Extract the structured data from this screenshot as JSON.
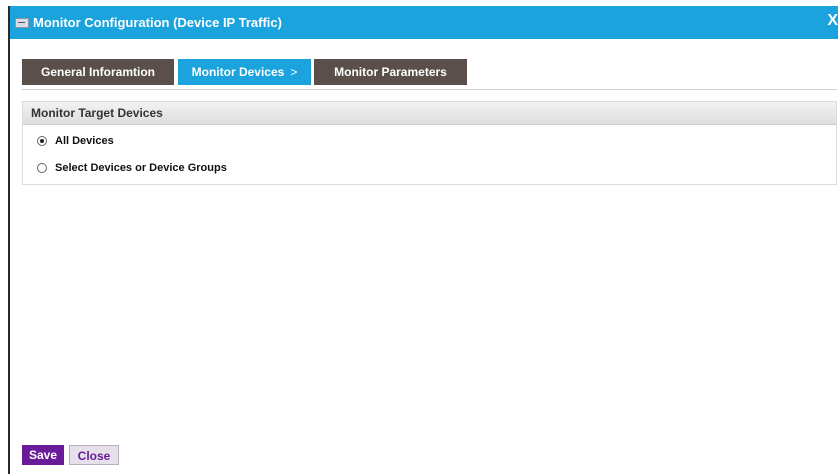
{
  "dialog": {
    "title": "Monitor Configuration (Device IP Traffic)",
    "close_glyph": "X",
    "title_icon": "app-window-icon"
  },
  "tabs": [
    {
      "label": "General Inforamtion",
      "active": false
    },
    {
      "label": "Monitor Devices",
      "active": true,
      "chevron": ">"
    },
    {
      "label": "Monitor Parameters",
      "active": false
    }
  ],
  "section": {
    "title": "Monitor Target Devices",
    "options": [
      {
        "label": "All Devices",
        "selected": true
      },
      {
        "label": "Select Devices or Device Groups",
        "selected": false
      }
    ]
  },
  "footer": {
    "save_label": "Save",
    "close_label": "Close"
  },
  "colors": {
    "titlebar": "#1aa3dd",
    "tab_active": "#1aa3dd",
    "tab_inactive": "#5a4f4b",
    "save_button": "#6a1b9a"
  }
}
